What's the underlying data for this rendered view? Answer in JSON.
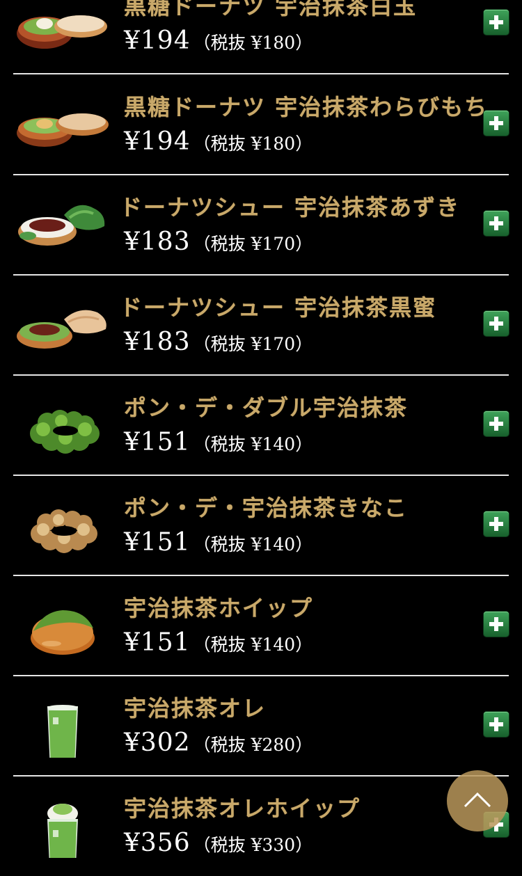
{
  "items": [
    {
      "name": "黒糖ドーナツ 宇治抹茶白玉",
      "price": "¥194",
      "tax_note": "（税抜 ¥180）",
      "image": "kokuto-donut-shiratama",
      "interactable_add": true
    },
    {
      "name": "黒糖ドーナツ 宇治抹茶わらびもち",
      "price": "¥194",
      "tax_note": "（税抜 ¥180）",
      "image": "kokuto-donut-warabimochi",
      "interactable_add": true
    },
    {
      "name": "ドーナツシュー 宇治抹茶あずき",
      "price": "¥183",
      "tax_note": "（税抜 ¥170）",
      "image": "donut-chou-azuki",
      "interactable_add": true
    },
    {
      "name": "ドーナツシュー 宇治抹茶黒蜜",
      "price": "¥183",
      "tax_note": "（税抜 ¥170）",
      "image": "donut-chou-kuromitsu",
      "interactable_add": true
    },
    {
      "name": "ポン・デ・ダブル宇治抹茶",
      "price": "¥151",
      "tax_note": "（税抜 ¥140）",
      "image": "pon-de-double-matcha",
      "interactable_add": true
    },
    {
      "name": "ポン・デ・宇治抹茶きなこ",
      "price": "¥151",
      "tax_note": "（税抜 ¥140）",
      "image": "pon-de-matcha-kinako",
      "interactable_add": true
    },
    {
      "name": "宇治抹茶ホイップ",
      "price": "¥151",
      "tax_note": "（税抜 ¥140）",
      "image": "matcha-whip-donut",
      "interactable_add": true
    },
    {
      "name": "宇治抹茶オレ",
      "price": "¥302",
      "tax_note": "（税抜 ¥280）",
      "image": "matcha-latte-glass",
      "interactable_add": true
    },
    {
      "name": "宇治抹茶オレホイップ",
      "price": "¥356",
      "tax_note": "（税抜 ¥330）",
      "image": "matcha-latte-whip-glass",
      "interactable_add": true
    }
  ],
  "icons": {
    "add": "plus-icon",
    "scroll_top": "chevron-up-icon"
  },
  "colors": {
    "background": "#000000",
    "name_gold": "#c9a96a",
    "price_white": "#ffffff",
    "divider": "#e6e6e6",
    "add_button_green": "#2e8b47",
    "scroll_top_button": "#b8965a"
  }
}
